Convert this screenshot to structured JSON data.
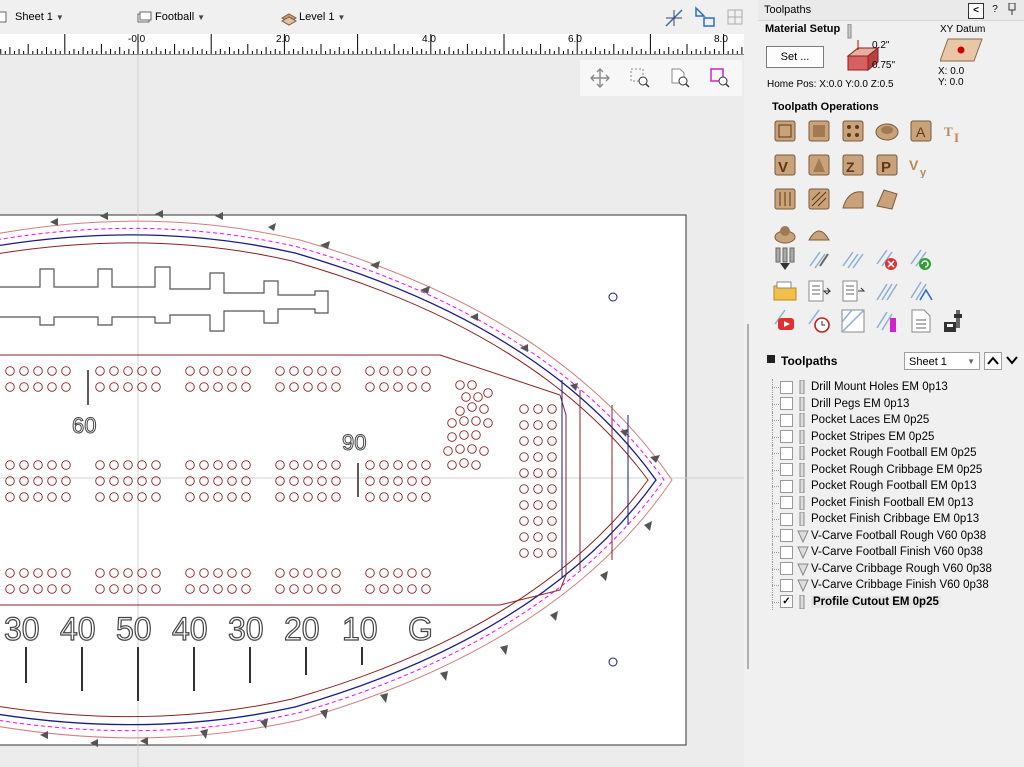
{
  "toolbar": {
    "sheet_label": "Sheet 1",
    "component_label": "Football",
    "level_label": "Level 1"
  },
  "ruler": {
    "labels": [
      "-0.0",
      "2.0",
      "4.0",
      "6.0",
      "8.0"
    ]
  },
  "panel": {
    "title": "Toolpaths",
    "help_label": "?",
    "material_setup_label": "Material Setup",
    "set_button_label": "Set ...",
    "depth_top": "0.2\"",
    "thickness": "0.75\"",
    "home_pos": "Home Pos:  X:0.0 Y:0.0 Z:0.5",
    "xy_datum_label": "XY Datum",
    "datum_x": "X: 0.0",
    "datum_y": "Y: 0.0",
    "operations_label": "Toolpath Operations",
    "toolpaths_label": "Toolpaths",
    "sheet_select": "Sheet 1"
  },
  "toolpaths": [
    {
      "name": "Drill Mount Holes EM 0p13",
      "checked": false,
      "tool": "endmill"
    },
    {
      "name": "Drill Pegs EM 0p13",
      "checked": false,
      "tool": "endmill"
    },
    {
      "name": "Pocket Laces EM 0p25",
      "checked": false,
      "tool": "endmill"
    },
    {
      "name": "Pocket Stripes EM 0p25",
      "checked": false,
      "tool": "endmill"
    },
    {
      "name": "Pocket Rough Football EM 0p25",
      "checked": false,
      "tool": "endmill"
    },
    {
      "name": "Pocket Rough Cribbage EM 0p25",
      "checked": false,
      "tool": "endmill"
    },
    {
      "name": "Pocket Rough Football EM 0p13",
      "checked": false,
      "tool": "endmill"
    },
    {
      "name": "Pocket Finish Football EM 0p13",
      "checked": false,
      "tool": "endmill"
    },
    {
      "name": "Pocket Finish Cribbage EM 0p13",
      "checked": false,
      "tool": "endmill"
    },
    {
      "name": "V-Carve Football Rough V60 0p38",
      "checked": false,
      "tool": "vbit"
    },
    {
      "name": "V-Carve Football Finish V60 0p38",
      "checked": false,
      "tool": "vbit"
    },
    {
      "name": "V-Carve Cribbage Rough V60 0p38",
      "checked": false,
      "tool": "vbit"
    },
    {
      "name": "V-Carve Cribbage Finish V60 0p38",
      "checked": false,
      "tool": "vbit"
    },
    {
      "name": "Profile Cutout EM 0p25",
      "checked": true,
      "tool": "endmill",
      "active": true
    }
  ],
  "drawing": {
    "yard_numbers": [
      "30",
      "40",
      "50",
      "40",
      "30",
      "20",
      "10",
      "G"
    ],
    "peg_label_60": "60",
    "peg_label_90": "90"
  },
  "colors": {
    "stock": "#ffffff",
    "vector": "#8b2020",
    "toolpath": "#d08080",
    "margin": "#ff00ff",
    "outline": "#1a1a8a",
    "tool_icon": "#c9a27a"
  }
}
